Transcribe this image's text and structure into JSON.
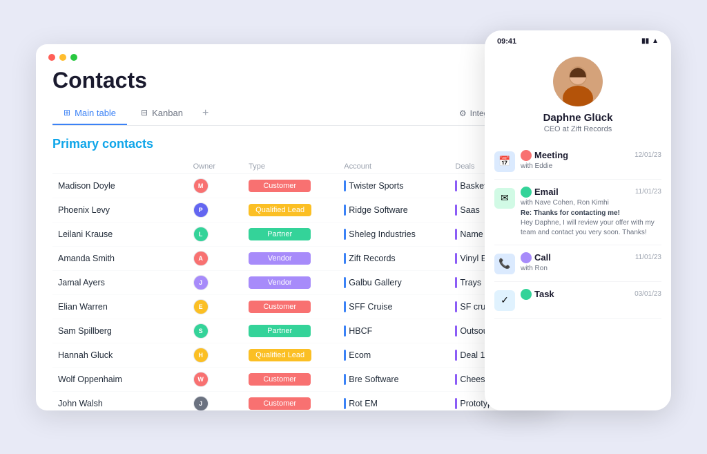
{
  "crm": {
    "title": "Contacts",
    "titlebar_dots": [
      "red",
      "yellow",
      "green"
    ],
    "tabs": [
      {
        "label": "Main table",
        "icon": "⊞",
        "active": true
      },
      {
        "label": "Kanban",
        "icon": "⊟",
        "active": false
      }
    ],
    "tab_add": "+",
    "integrate_label": "Integrate",
    "section_title": "Primary contacts",
    "table": {
      "headers": [
        "",
        "Owner",
        "Type",
        "Account",
        "Deals"
      ],
      "rows": [
        {
          "name": "Madison Doyle",
          "owner_color": "#f87171",
          "type": "Customer",
          "type_class": "badge-customer",
          "account": "Twister Sports",
          "deals": "Basketball"
        },
        {
          "name": "Phoenix Levy",
          "owner_color": "#6366f1",
          "type": "Qualified Lead",
          "type_class": "badge-qualified",
          "account": "Ridge Software",
          "deals": "Saas"
        },
        {
          "name": "Leilani Krause",
          "owner_color": "#34d399",
          "type": "Partner",
          "type_class": "badge-partner",
          "account": "Sheleg Industries",
          "deals": "Name pat"
        },
        {
          "name": "Amanda Smith",
          "owner_color": "#f87171",
          "type": "Vendor",
          "type_class": "badge-vendor",
          "account": "Zift Records",
          "deals": "Vinyl EP"
        },
        {
          "name": "Jamal Ayers",
          "owner_color": "#a78bfa",
          "type": "Vendor",
          "type_class": "badge-vendor",
          "account": "Galbu Gallery",
          "deals": "Trays"
        },
        {
          "name": "Elian Warren",
          "owner_color": "#fbbf24",
          "type": "Customer",
          "type_class": "badge-customer",
          "account": "SFF Cruise",
          "deals": "SF cruise"
        },
        {
          "name": "Sam Spillberg",
          "owner_color": "#34d399",
          "type": "Partner",
          "type_class": "badge-partner",
          "account": "HBCF",
          "deals": "Outsourci"
        },
        {
          "name": "Hannah Gluck",
          "owner_color": "#fbbf24",
          "type": "Qualified Lead",
          "type_class": "badge-qualified",
          "account": "Ecom",
          "deals": "Deal 1"
        },
        {
          "name": "Wolf Oppenhaim",
          "owner_color": "#f87171",
          "type": "Customer",
          "type_class": "badge-customer",
          "account": "Bre Software",
          "deals": "Cheese da"
        },
        {
          "name": "John Walsh",
          "owner_color": "#6b7280",
          "type": "Customer",
          "type_class": "badge-customer",
          "account": "Rot EM",
          "deals": "Prototype"
        }
      ]
    }
  },
  "mobile": {
    "statusbar_time": "09:41",
    "profile": {
      "name": "Daphne Glück",
      "subtitle": "CEO at Zift Records"
    },
    "activities": [
      {
        "icon": "📅",
        "icon_class": "activity-icon-meeting",
        "type": "Meeting",
        "date": "12/01/23",
        "sub": "with Eddie",
        "body": ""
      },
      {
        "icon": "✉",
        "icon_class": "activity-icon-email",
        "type": "Email",
        "date": "11/01/23",
        "sub": "with Nave Cohen, Ron Kimhi",
        "body_highlight": "Re: Thanks for contacting me!",
        "body": "Hey Daphne, I will review your offer with my team and contact you very soon. Thanks!"
      },
      {
        "icon": "📞",
        "icon_class": "activity-icon-call",
        "type": "Call",
        "date": "11/01/23",
        "sub": "with Ron",
        "body": ""
      },
      {
        "icon": "✓",
        "icon_class": "activity-icon-task",
        "type": "Task",
        "date": "03/01/23",
        "sub": "",
        "body": ""
      }
    ]
  }
}
